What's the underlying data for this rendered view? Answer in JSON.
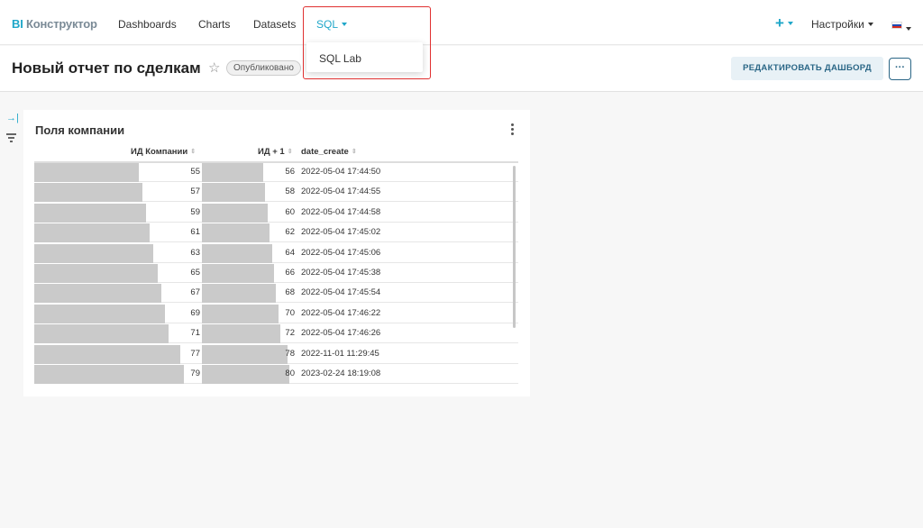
{
  "nav": {
    "brand_bi": "BI",
    "brand_name": "Конструктор",
    "dashboards": "Dashboards",
    "charts": "Charts",
    "datasets": "Datasets",
    "sql": "SQL",
    "plus": "+",
    "settings": "Настройки",
    "sql_dropdown": [
      "SQL Lab"
    ]
  },
  "header": {
    "title": "Новый отчет по сделкам",
    "status": "Опубликовано",
    "edit_button": "РЕДАКТИРОВАТЬ ДАШБОРД",
    "more_button": "···"
  },
  "chart": {
    "title": "Поля компании",
    "columns": [
      "ИД Компании",
      "ИД + 1",
      "date_create"
    ],
    "rows": [
      {
        "id": "55",
        "id_plus": "56",
        "date": "2022-05-04 17:44:50"
      },
      {
        "id": "57",
        "id_plus": "58",
        "date": "2022-05-04 17:44:55"
      },
      {
        "id": "59",
        "id_plus": "60",
        "date": "2022-05-04 17:44:58"
      },
      {
        "id": "61",
        "id_plus": "62",
        "date": "2022-05-04 17:45:02"
      },
      {
        "id": "63",
        "id_plus": "64",
        "date": "2022-05-04 17:45:06"
      },
      {
        "id": "65",
        "id_plus": "66",
        "date": "2022-05-04 17:45:38"
      },
      {
        "id": "67",
        "id_plus": "68",
        "date": "2022-05-04 17:45:54"
      },
      {
        "id": "69",
        "id_plus": "70",
        "date": "2022-05-04 17:46:22"
      },
      {
        "id": "71",
        "id_plus": "72",
        "date": "2022-05-04 17:46:26"
      },
      {
        "id": "77",
        "id_plus": "78",
        "date": "2022-11-01 11:29:45"
      },
      {
        "id": "79",
        "id_plus": "80",
        "date": "2023-02-24 18:19:08"
      },
      {
        "id": "",
        "id_plus": "",
        "date": ""
      }
    ]
  },
  "colors": {
    "accent": "#20a7c9",
    "bar": "#cacaca",
    "highlight": "#e03131"
  }
}
